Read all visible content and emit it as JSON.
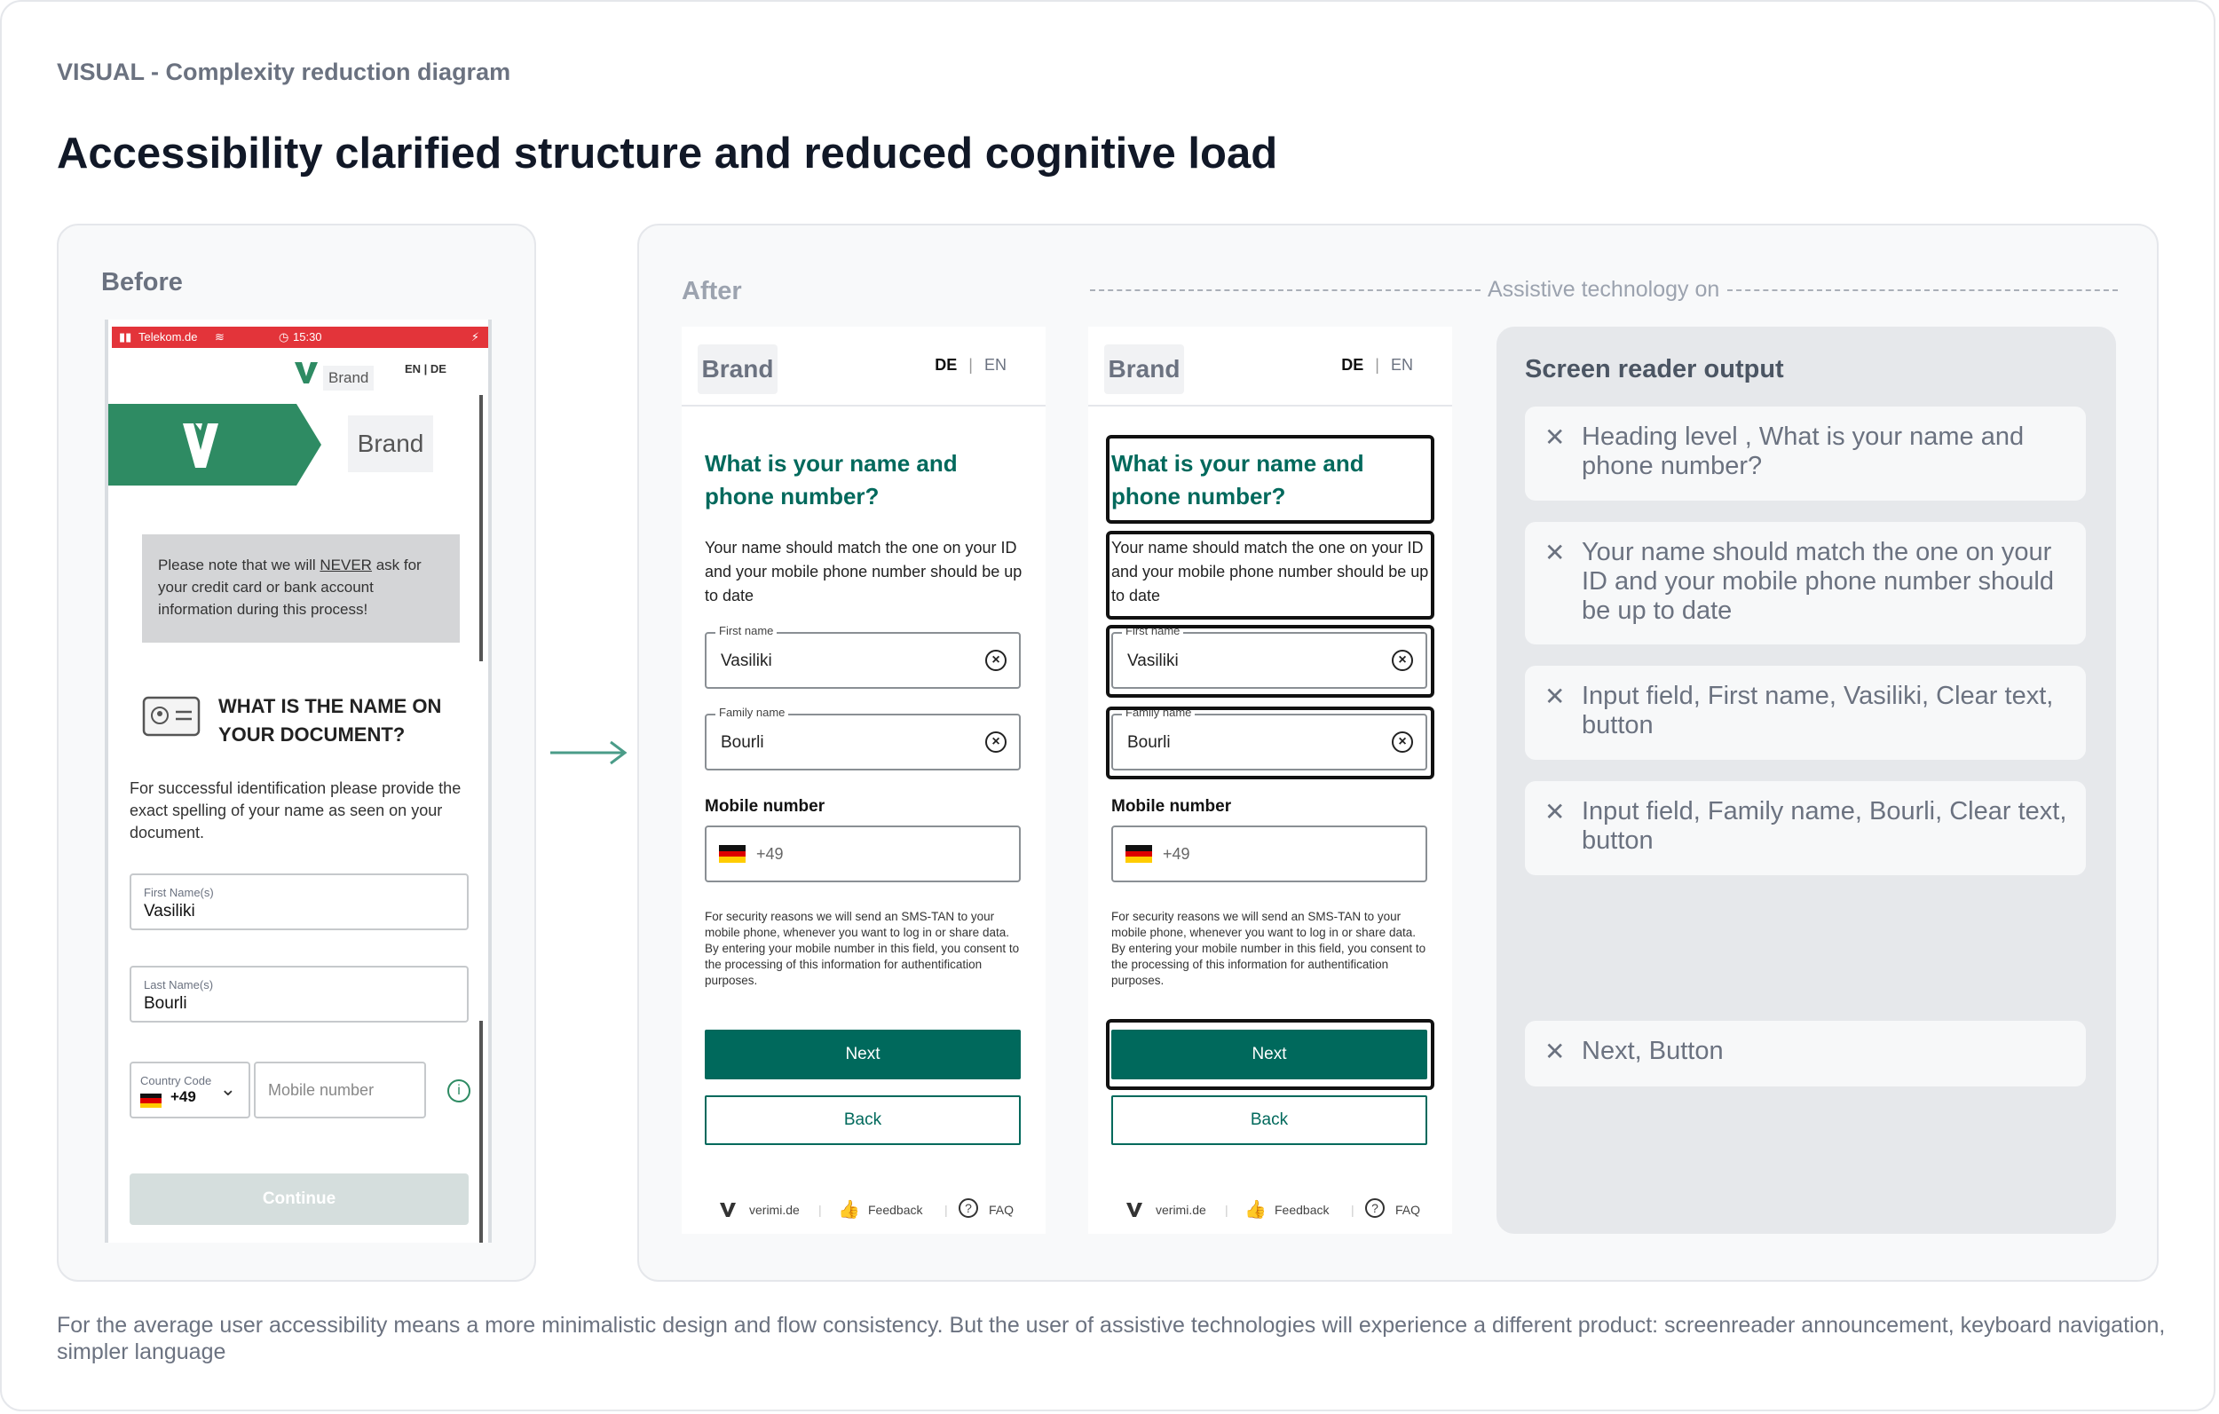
{
  "eyebrow": "VISUAL - Complexity reduction diagram",
  "title": "Accessibility clarified structure and reduced cognitive load",
  "caption": "For the average user accessibility means a more minimalistic design and flow consistency. But the user of assistive technologies will experience a different product: screenreader announcement, keyboard navigation, simpler language",
  "before": {
    "label": "Before",
    "status": {
      "carrier": "Telekom.de",
      "time": "15:30"
    },
    "brand_small": "Brand",
    "lang": "EN | DE",
    "brand_banner": "Brand",
    "notice_pre": "Please note that we will ",
    "notice_emph": "NEVER",
    "notice_post": " ask for your credit card or bank account information during this process!",
    "doc_heading": "WHAT IS THE NAME ON YOUR DOCUMENT?",
    "doc_desc": "For successful identification please provide the exact spelling of your name as seen on your document.",
    "first_label": "First Name(s)",
    "first_value": "Vasiliki",
    "last_label": "Last Name(s)",
    "last_value": "Bourli",
    "country_label": "Country Code",
    "country_value": "+49",
    "mobile_placeholder": "Mobile number",
    "continue": "Continue"
  },
  "after": {
    "label": "After",
    "at_label": "Assistive technology on",
    "brand": "Brand",
    "lang_de": "DE",
    "lang_sep": "|",
    "lang_en": "EN",
    "question": "What is your name and phone number?",
    "desc": "Your name should match the one on your ID and your mobile phone number should be up to date",
    "first_label": "First name",
    "first_value": "Vasiliki",
    "family_label": "Family name",
    "family_value": "Bourli",
    "mobile_label": "Mobile number",
    "phone_code": "+49",
    "note": "For security reasons we will send an SMS-TAN to your mobile phone, whenever you want to log in or share data. By entering your mobile number in this field, you consent to the processing of this information for authentification purposes.",
    "next": "Next",
    "back": "Back",
    "footer": {
      "site": "verimi.de",
      "feedback": "Feedback",
      "faq": "FAQ"
    }
  },
  "screen_reader": {
    "title": "Screen reader output",
    "items": [
      "Heading level , What is your name and phone number?",
      "Your name should match the one on your ID and your mobile phone number should be up to date",
      "Input field, First name, Vasiliki, Clear text, button",
      "Input field, Family name, Bourli, Clear text, button",
      "Next, Button"
    ]
  },
  "colors": {
    "brand_green": "#00695c",
    "banner_green": "#2e8b63",
    "status_red": "#e3343a",
    "arrow": "#4a9c88"
  }
}
